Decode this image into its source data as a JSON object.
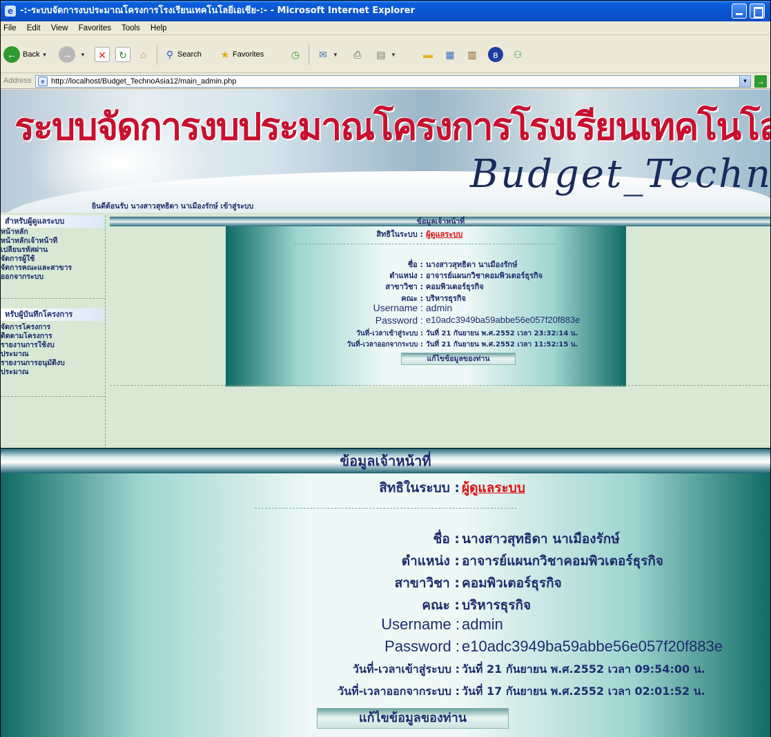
{
  "browser": {
    "title": "-:-ระบบจัดการงบประมาณโครงการโรงเรียนเทคโนโลยีเอเชีย-:- - Microsoft Internet Explorer",
    "menu": [
      "File",
      "Edit",
      "View",
      "Favorites",
      "Tools",
      "Help"
    ],
    "toolbar": {
      "back": "Back",
      "search": "Search",
      "favorites": "Favorites"
    },
    "address_label": "Address",
    "address": "http://localhost/Budget_TechnoAsia12/main_admin.php"
  },
  "banner": {
    "title": "ระบบจัดการงบประมาณโครงการโรงเรียนเทคโนโลยีเอเชี",
    "script": "Budget_Technoas",
    "welcome": "ยินดีต้อนรับ นางสาวสุทธิดา นาเมืองรักษ์ เข้าสู่ระบบ"
  },
  "sidebar": {
    "admin_head": "สำหรับผู้ดูแลระบบ",
    "admin_items": [
      "หน้าหลัก",
      "หน้าหลักเจ้าหน้าที่",
      "เปลี่ยนรหัสผ่าน",
      "จัดการผู้ใช้",
      "จัดการคณะและสาขาร",
      "ออกจากระบบ"
    ],
    "project_head": "หรับผู้บันทึกโครงการ",
    "project_items": [
      "จัดการโครงการ",
      "ติดตามโครงการ",
      "รายงานการใช้งบ",
      "ประมาณ",
      "รายงานการอนุมัติงบ",
      "ประมาณ"
    ]
  },
  "info": {
    "header": "ข้อมูลเจ้าหน้าที่",
    "role_label": "สิทธิในระบบ :",
    "role": "ผู้ดูแลระบบ",
    "name_label": "ชื่อ :",
    "name": "นางสาวสุทธิดา นาเมืองรักษ์",
    "position_label": "ตำแหน่ง :",
    "position": "อาจารย์แผนกวิชาคอมพิวเตอร์ธุรกิจ",
    "major_label": "สาขาวิชา :",
    "major": "คอมพิวเตอร์ธุรกิจ",
    "faculty_label": "คณะ :",
    "faculty": "บริหารธุรกิจ",
    "username_label": "Username :",
    "username": "admin",
    "password_label": "Password :",
    "password": "e10adc3949ba59abbe56e057f20f883e",
    "login_label": "วันที่-เวลาเข้าสู่ระบบ :",
    "logout_label": "วันที่-เวลาออกจากระบบ :",
    "edit_button": "แก้ไขข้อมูลของท่าน"
  },
  "window_info": {
    "login": "วันที่ 21 กันยายน พ.ศ.2552 เวลา 23:32:14 น.",
    "logout": "วันที่ 21 กันยายน พ.ศ.2552 เวลา 11:52:15 น."
  },
  "zoom_info": {
    "login": "วันที่ 21 กันยายน พ.ศ.2552 เวลา 09:54:00 น.",
    "logout": "วันที่ 17 กันยายน พ.ศ.2552 เวลา 02:01:52 น."
  },
  "colors": {
    "title_bar": "#0855d1",
    "banner_title": "#c8102e",
    "role": "#e01010",
    "panel_teal": "#0f6a64"
  }
}
